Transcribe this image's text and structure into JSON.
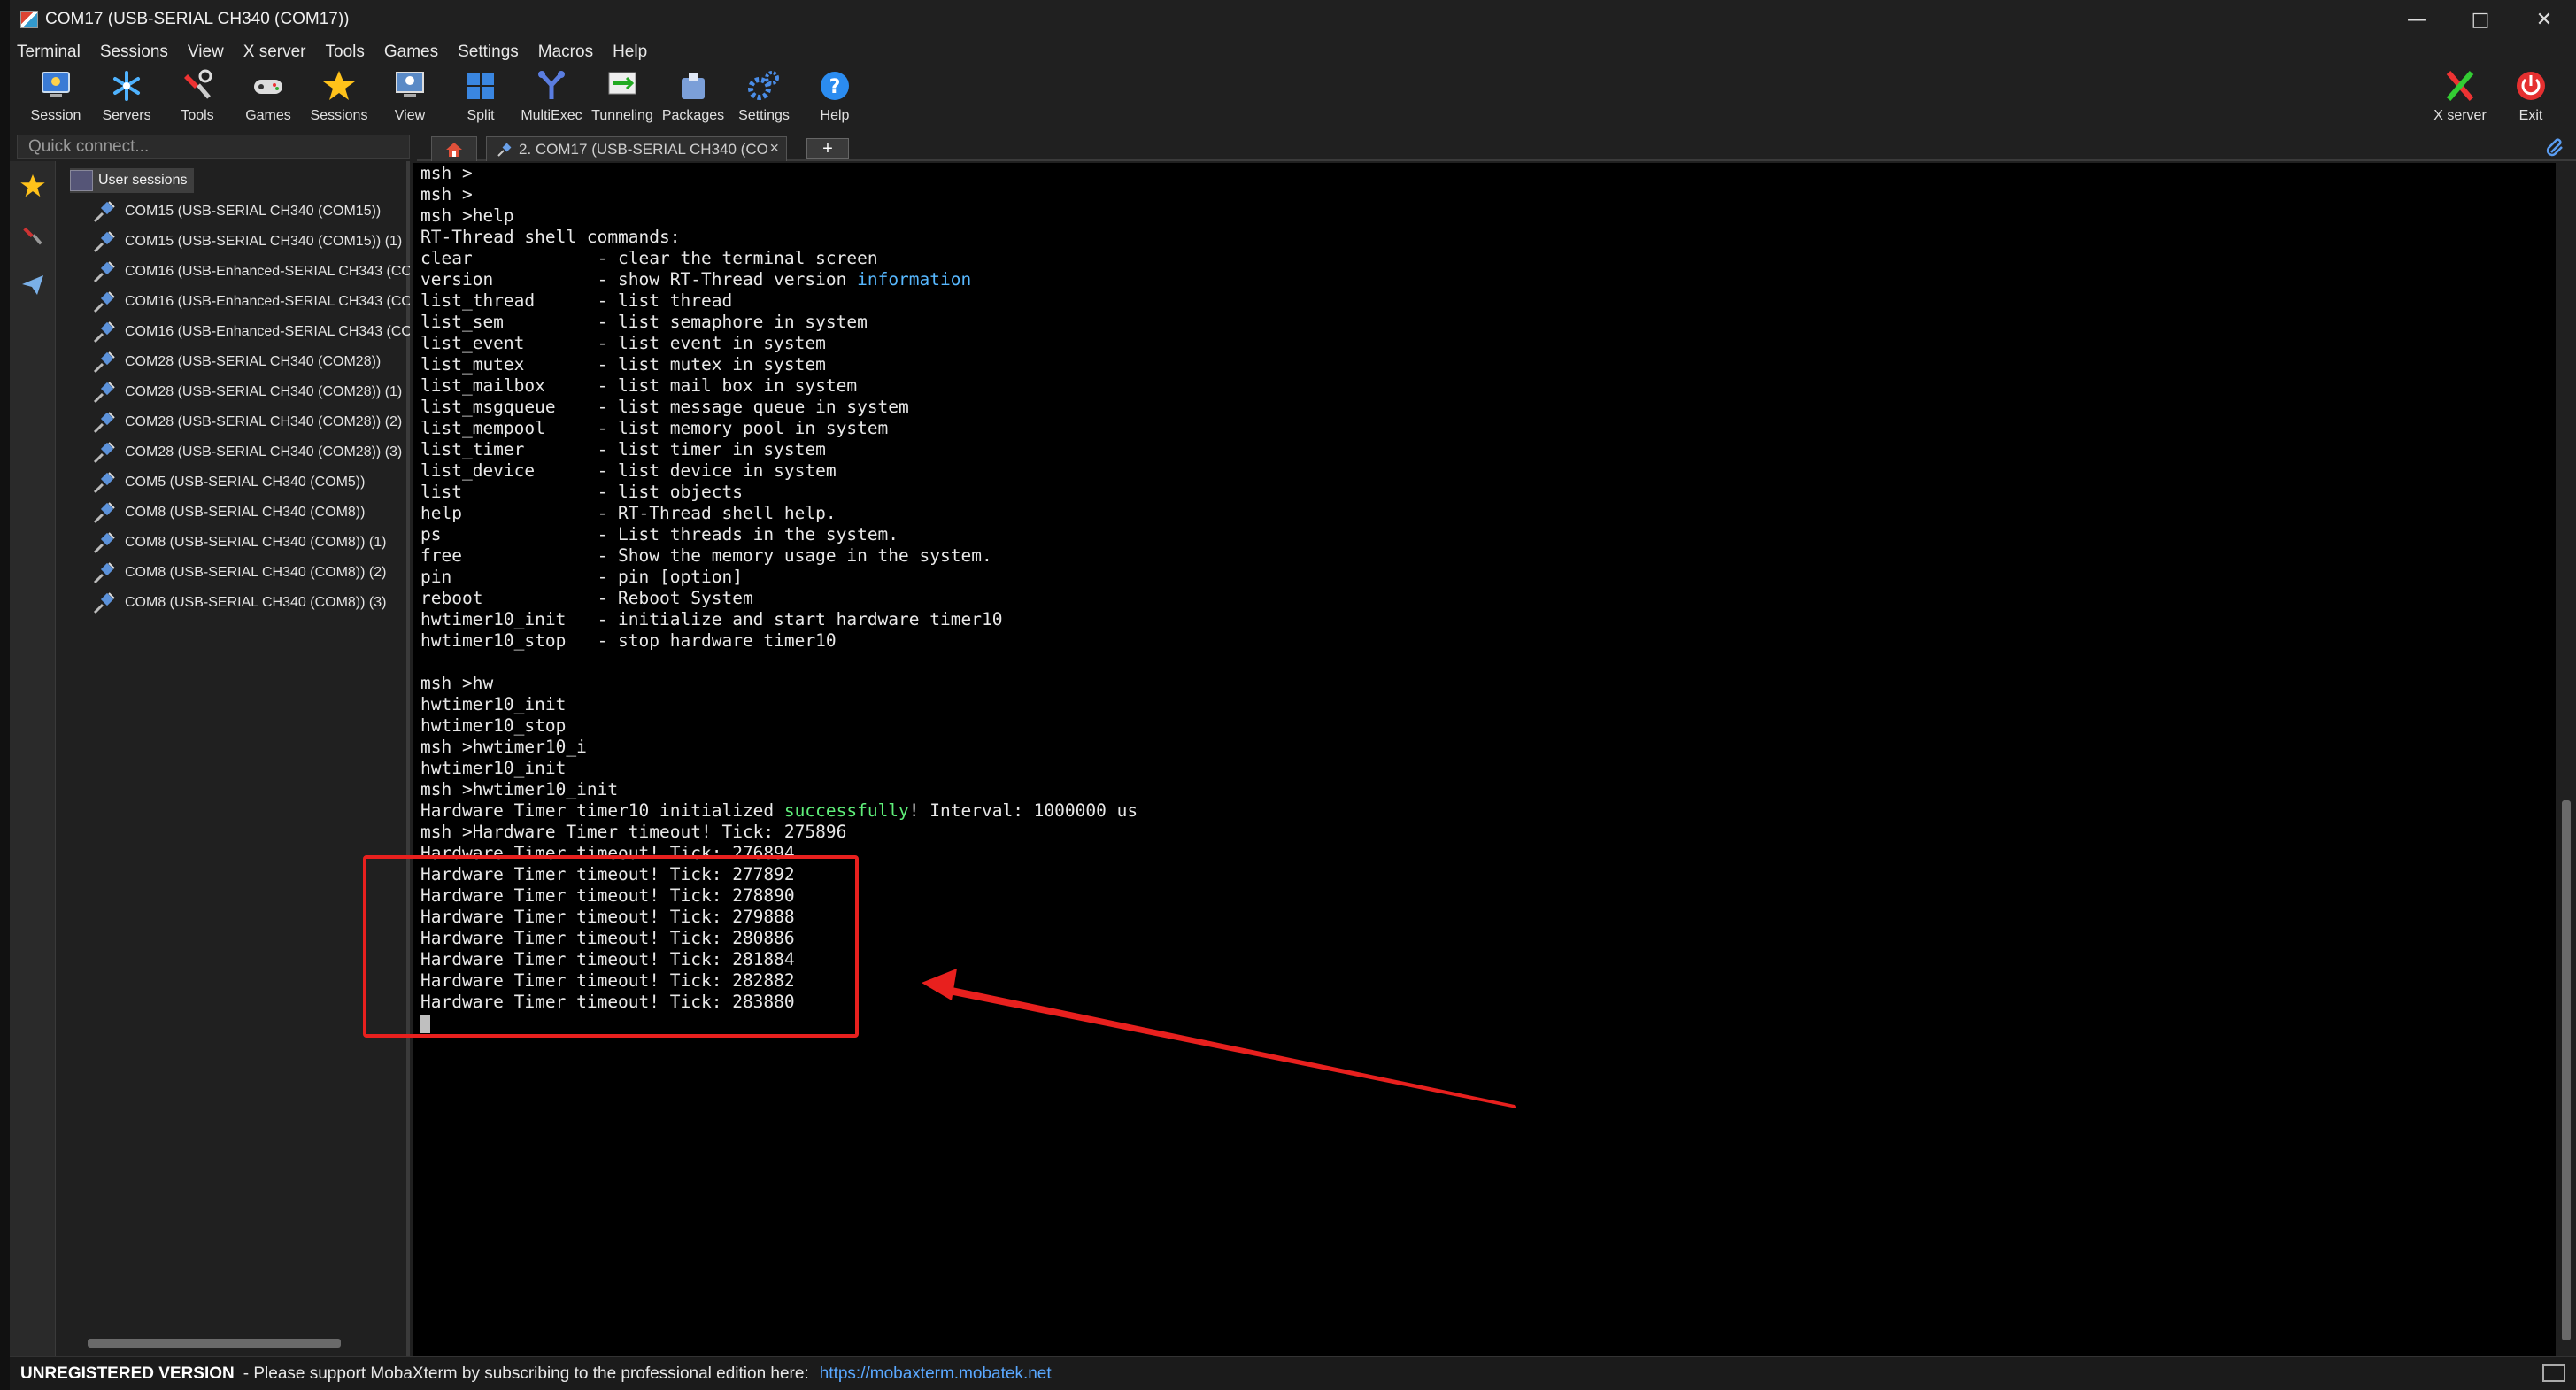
{
  "window": {
    "title": "COM17  (USB-SERIAL CH340 (COM17))",
    "minimize": "—",
    "maximize": "□",
    "close": "✕"
  },
  "menu": [
    "Terminal",
    "Sessions",
    "View",
    "X server",
    "Tools",
    "Games",
    "Settings",
    "Macros",
    "Help"
  ],
  "toolbar": {
    "items": [
      {
        "label": "Session",
        "icon": "session-icon"
      },
      {
        "label": "Servers",
        "icon": "servers-icon"
      },
      {
        "label": "Tools",
        "icon": "tools-icon"
      },
      {
        "label": "Games",
        "icon": "games-icon"
      },
      {
        "label": "Sessions",
        "icon": "sessions-star-icon"
      },
      {
        "label": "View",
        "icon": "view-icon"
      },
      {
        "label": "Split",
        "icon": "split-icon"
      },
      {
        "label": "MultiExec",
        "icon": "multiexec-icon"
      },
      {
        "label": "Tunneling",
        "icon": "tunneling-icon"
      },
      {
        "label": "Packages",
        "icon": "packages-icon"
      },
      {
        "label": "Settings",
        "icon": "settings-icon"
      },
      {
        "label": "Help",
        "icon": "help-icon"
      }
    ],
    "xserver_label": "X server",
    "exit_label": "Exit"
  },
  "quick_connect": {
    "placeholder": "Quick connect..."
  },
  "tabs": {
    "active_label": "2. COM17  (USB-SERIAL CH340 (CO",
    "close": "×",
    "add": "+"
  },
  "sessions": {
    "header": "User sessions",
    "items": [
      "COM15  (USB-SERIAL CH340 (COM15))",
      "COM15  (USB-SERIAL CH340 (COM15)) (1)",
      "COM16  (USB-Enhanced-SERIAL CH343 (CO",
      "COM16  (USB-Enhanced-SERIAL CH343 (CO",
      "COM16  (USB-Enhanced-SERIAL CH343 (CO",
      "COM28  (USB-SERIAL CH340 (COM28))",
      "COM28  (USB-SERIAL CH340 (COM28)) (1)",
      "COM28  (USB-SERIAL CH340 (COM28)) (2)",
      "COM28  (USB-SERIAL CH340 (COM28)) (3)",
      "COM5  (USB-SERIAL CH340 (COM5))",
      "COM8  (USB-SERIAL CH340 (COM8))",
      "COM8  (USB-SERIAL CH340 (COM8)) (1)",
      "COM8  (USB-SERIAL CH340 (COM8)) (2)",
      "COM8  (USB-SERIAL CH340 (COM8)) (3)"
    ]
  },
  "terminal": {
    "lines": [
      "msh >",
      "msh >",
      "msh >help",
      "RT-Thread shell commands:",
      "clear            - clear the terminal screen",
      [
        "version          - show RT-Thread version ",
        {
          "t": "information",
          "c": "blue"
        }
      ],
      "list_thread      - list thread",
      "list_sem         - list semaphore in system",
      "list_event       - list event in system",
      "list_mutex       - list mutex in system",
      "list_mailbox     - list mail box in system",
      "list_msgqueue    - list message queue in system",
      "list_mempool     - list memory pool in system",
      "list_timer       - list timer in system",
      "list_device      - list device in system",
      "list             - list objects",
      "help             - RT-Thread shell help.",
      "ps               - List threads in the system.",
      "free             - Show the memory usage in the system.",
      "pin              - pin [option]",
      "reboot           - Reboot System",
      "hwtimer10_init   - initialize and start hardware timer10",
      "hwtimer10_stop   - stop hardware timer10",
      "",
      "msh >hw",
      "hwtimer10_init",
      "hwtimer10_stop",
      "msh >hwtimer10_i",
      "hwtimer10_init",
      "msh >hwtimer10_init",
      [
        "Hardware Timer timer10 initialized ",
        {
          "t": "successfully",
          "c": "green"
        },
        "! Interval: 1000000 us"
      ],
      "msh >Hardware Timer timeout! Tick: 275896",
      "Hardware Timer timeout! Tick: 276894",
      "Hardware Timer timeout! Tick: 277892",
      "Hardware Timer timeout! Tick: 278890",
      "Hardware Timer timeout! Tick: 279888",
      "Hardware Timer timeout! Tick: 280886",
      "Hardware Timer timeout! Tick: 281884",
      "Hardware Timer timeout! Tick: 282882",
      "Hardware Timer timeout! Tick: 283880"
    ]
  },
  "status": {
    "unregistered": "UNREGISTERED VERSION",
    "message": "-  Please support MobaXterm by subscribing to the professional edition here:",
    "link": "https://mobaxterm.mobatek.net"
  },
  "colors": {
    "highlight_box": "#e8201e",
    "link": "#5aa8ff",
    "info_blue": "#57b8ff",
    "success_green": "#5ff07a"
  }
}
